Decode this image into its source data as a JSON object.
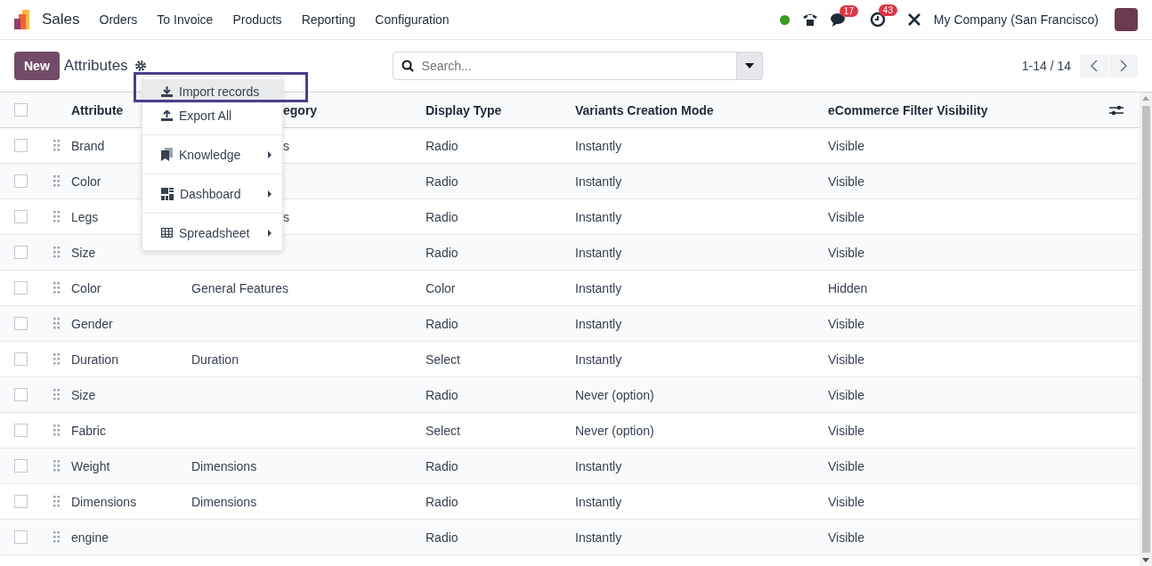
{
  "navbar": {
    "app": "Sales",
    "menu": [
      "Orders",
      "To Invoice",
      "Products",
      "Reporting",
      "Configuration"
    ],
    "messages_badge": "17",
    "activities_badge": "43",
    "company": "My Company (San Francisco)"
  },
  "control": {
    "new_button": "New",
    "title": "Attributes",
    "search": {
      "placeholder": "Search..."
    },
    "pager": "1-14 / 14"
  },
  "actions_menu": {
    "groups": [
      [
        {
          "label": "Import records",
          "kind": "import",
          "selected": true,
          "submenu": false
        },
        {
          "label": "Export All",
          "kind": "export",
          "selected": false,
          "submenu": false
        }
      ],
      [
        {
          "label": "Knowledge",
          "kind": "knowledge",
          "selected": false,
          "submenu": true
        }
      ],
      [
        {
          "label": "Dashboard",
          "kind": "dashboard",
          "selected": false,
          "submenu": true
        }
      ],
      [
        {
          "label": "Spreadsheet",
          "kind": "spreadsheet",
          "selected": false,
          "submenu": true
        }
      ]
    ]
  },
  "table": {
    "all_checked": false,
    "columns": [
      {
        "label": "Attribute",
        "cut": false
      },
      {
        "label": "egory",
        "cut": true
      },
      {
        "label": "Display Type",
        "cut": false
      },
      {
        "label": "Variants Creation Mode",
        "cut": false
      },
      {
        "label": "eCommerce Filter Visibility",
        "cut": false
      }
    ],
    "rows": [
      {
        "checked": false,
        "attribute": "Brand",
        "category": "s",
        "category_cut": true,
        "display_type": "Radio",
        "variants": "Instantly",
        "visibility": "Visible"
      },
      {
        "checked": false,
        "attribute": "Color",
        "display_type": "Radio",
        "variants": "Instantly",
        "visibility": "Visible"
      },
      {
        "checked": false,
        "attribute": "Legs",
        "category": "s",
        "category_cut": true,
        "display_type": "Radio",
        "variants": "Instantly",
        "visibility": "Visible"
      },
      {
        "checked": false,
        "attribute": "Size",
        "display_type": "Radio",
        "variants": "Instantly",
        "visibility": "Visible"
      },
      {
        "checked": false,
        "attribute": "Color",
        "category": "General Features",
        "category_cut": false,
        "display_type": "Color",
        "variants": "Instantly",
        "visibility": "Hidden"
      },
      {
        "checked": false,
        "attribute": "Gender",
        "display_type": "Radio",
        "variants": "Instantly",
        "visibility": "Visible"
      },
      {
        "checked": false,
        "attribute": "Duration",
        "category": "Duration",
        "category_cut": false,
        "display_type": "Select",
        "variants": "Instantly",
        "visibility": "Visible"
      },
      {
        "checked": false,
        "attribute": "Size",
        "display_type": "Radio",
        "variants": "Never (option)",
        "visibility": "Visible"
      },
      {
        "checked": false,
        "attribute": "Fabric",
        "display_type": "Select",
        "variants": "Never (option)",
        "visibility": "Visible"
      },
      {
        "checked": false,
        "attribute": "Weight",
        "category": "Dimensions",
        "category_cut": false,
        "display_type": "Radio",
        "variants": "Instantly",
        "visibility": "Visible"
      },
      {
        "checked": false,
        "attribute": "Dimensions",
        "category": "Dimensions",
        "category_cut": false,
        "display_type": "Radio",
        "variants": "Instantly",
        "visibility": "Visible"
      },
      {
        "checked": false,
        "attribute": "engine",
        "display_type": "Radio",
        "variants": "Instantly",
        "visibility": "Visible"
      }
    ]
  }
}
